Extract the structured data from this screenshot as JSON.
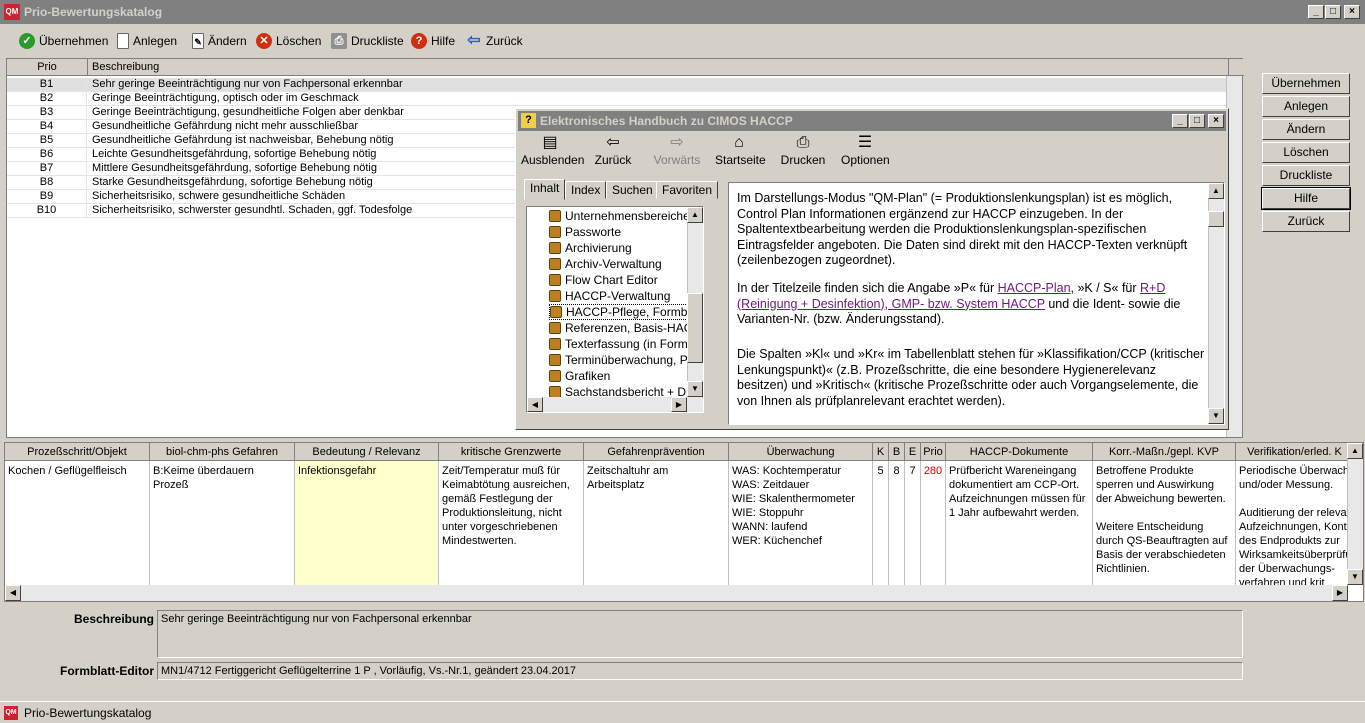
{
  "window": {
    "title": "Prio-Bewertungskatalog",
    "icon": "qm-app-icon"
  },
  "toolbar": [
    {
      "label": "Übernehmen",
      "icon": "check-icon",
      "color": "#2a9a2a"
    },
    {
      "label": "Anlegen",
      "icon": "new-doc-icon",
      "color": "#ffffff"
    },
    {
      "label": "Ändern",
      "icon": "edit-icon",
      "color": "#ffffff"
    },
    {
      "label": "Löschen",
      "icon": "delete-icon",
      "color": "#d03010"
    },
    {
      "label": "Druckliste",
      "icon": "printer-icon",
      "color": "#808080"
    },
    {
      "label": "Hilfe",
      "icon": "help-icon",
      "color": "#d03010"
    },
    {
      "label": "Zurück",
      "icon": "back-arrow-icon",
      "color": "#3060c0"
    }
  ],
  "grid": {
    "headers": [
      "Prio",
      "Beschreibung"
    ],
    "rows": [
      {
        "prio": "B1",
        "text": "Sehr geringe Beeinträchtigung nur von Fachpersonal erkennbar"
      },
      {
        "prio": "B2",
        "text": "Geringe Beeinträchtigung, optisch oder im Geschmack"
      },
      {
        "prio": "B3",
        "text": "Geringe Beeinträchtigung, gesundheitliche Folgen aber denkbar"
      },
      {
        "prio": "B4",
        "text": "Gesundheitliche Gefährdung nicht mehr ausschließbar"
      },
      {
        "prio": "B5",
        "text": "Gesundheitliche Gefährdung ist nachweisbar, Behebung nötig"
      },
      {
        "prio": "B6",
        "text": "Leichte Gesundheitsgefährdung, sofortige Behebung nötig"
      },
      {
        "prio": "B7",
        "text": "Mittlere Gesundheitsgefährdung, sofortige Behebung nötig"
      },
      {
        "prio": "B8",
        "text": "Starke Gesundheitsgefährdung, sofortige Behebung nötig"
      },
      {
        "prio": "B9",
        "text": "Sicherheitsrisiko, schwere gesundheitliche Schäden"
      },
      {
        "prio": "B10",
        "text": "Sicherheitsrisiko, schwerster gesundhtl. Schaden, ggf. Todesfolge"
      }
    ]
  },
  "side_buttons": [
    "Übernehmen",
    "Anlegen",
    "Ändern",
    "Löschen",
    "Druckliste",
    "Hilfe",
    "Zurück"
  ],
  "help": {
    "title": "Elektronisches Handbuch zu CIMOS HACCP",
    "toolbar": [
      {
        "label": "Ausblenden",
        "icon": "hide-pane-icon",
        "glyph": "▤"
      },
      {
        "label": "Zurück",
        "icon": "back-icon",
        "glyph": "⇦"
      },
      {
        "label": "Vorwärts",
        "icon": "forward-icon",
        "glyph": "⇨"
      },
      {
        "label": "Startseite",
        "icon": "home-icon",
        "glyph": "⌂"
      },
      {
        "label": "Drucken",
        "icon": "print-icon",
        "glyph": "⎙"
      },
      {
        "label": "Optionen",
        "icon": "options-icon",
        "glyph": "☰"
      }
    ],
    "tabs": [
      "Inhalt",
      "Index",
      "Suchen",
      "Favoriten"
    ],
    "tree": [
      "Unternehmensbereiche (I",
      "Passworte",
      "Archivierung",
      "Archiv-Verwaltung",
      "Flow Chart Editor",
      "HACCP-Verwaltung",
      "HACCP-Pflege, Formblatt",
      "Referenzen, Basis-HACC",
      "Texterfassung (in Formula",
      "Terminüberwachung, Pric",
      "Grafiken",
      "Sachstandsbericht + Diag"
    ],
    "para1": "Im Darstellungs-Modus \"QM-Plan\" (= Produktionslenkungsplan) ist es  möglich, Control Plan Informationen ergänzend zur HACCP einzugeben. In der Spaltentextbearbeitung werden die Produktionslenkungsplan-spezifischen Eintragsfelder angeboten. Die Daten sind direkt mit den  HACCP-Texten  verknüpft (zeilenbezogen zugeordnet).",
    "para2_a": "In der Titelzeile finden sich die Angabe »P« für ",
    "para2_link1": "HACCP-Plan",
    "para2_b": ", »K / S« für ",
    "para2_link2": "R+D (Reinigung + Desinfektion), GMP- bzw. System HACCP",
    "para2_c": " und die Ident- sowie die Varianten-Nr. (bzw. Änderungsstand).",
    "para3": "Die Spalten »Kl« und »Kr« im Tabellenblatt stehen für »Klassifikation/CCP (kritischer Lenkungspunkt)« (z.B. Prozeßschritte, die eine besondere Hygienerelevanz besitzen) und »Kritisch« (kritische Prozeßschritte oder auch Vorgangselemente, die von Ihnen als prüfplanrelevant erachtet werden)."
  },
  "detail": {
    "headers": [
      "Prozeßschritt/Objekt",
      "biol-chm-phs Gefahren",
      "Bedeutung / Relevanz",
      "kritische Grenzwerte",
      "Gefahrenprävention",
      "Überwachung",
      "K",
      "B",
      "E",
      "Prio",
      "HACCP-Dokumente",
      "Korr.-Maßn./gepl. KVP",
      "Verifikation/erled. K"
    ],
    "cells": [
      "Kochen / Geflügelfleisch",
      "B:Keime überdauern Prozeß",
      "Infektionsgefahr",
      "Zeit/Temperatur muß für Keimabtötung ausreichen, gemäß Festlegung der Produktionsleitung, nicht unter vorgeschriebenen Mindestwerten.",
      "Zeitschaltuhr am Arbeitsplatz",
      "WAS: Kochtemperatur\nWAS: Zeitdauer\nWIE: Skalenthermometer\nWIE: Stoppuhr\nWANN: laufend\nWER: Küchenchef",
      "5",
      "8",
      "7",
      "280",
      "Prüfbericht Wareneingang dokumentiert am CCP-Ort. Aufzeichnungen müssen für 1 Jahr aufbewahrt werden.",
      "Betroffene Produkte sperren und Auswirkung der Abweichung bewerten.\n\nWeitere Entscheidung durch QS-Beauftragten auf Basis der verabschiedeten Richtlinien.",
      "Periodische Überwach und/oder Messung.\n\nAuditierung der releva Aufzeichnungen, Kont des Endprodukts zur Wirksamkeitsüberprüfu der Überwachungs- verfahren und krit"
    ]
  },
  "beschreibung": {
    "label": "Beschreibung",
    "value": "Sehr geringe Beeinträchtigung nur von Fachpersonal erkennbar"
  },
  "formblatt": {
    "label": "Formblatt-Editor",
    "value": "MN1/4712  Fertiggericht Geflügelterrine  1  P  , Vorläufig, Vs.-Nr.1, geändert  23.04.2017"
  },
  "status": {
    "text": "Prio-Bewertungskatalog"
  }
}
